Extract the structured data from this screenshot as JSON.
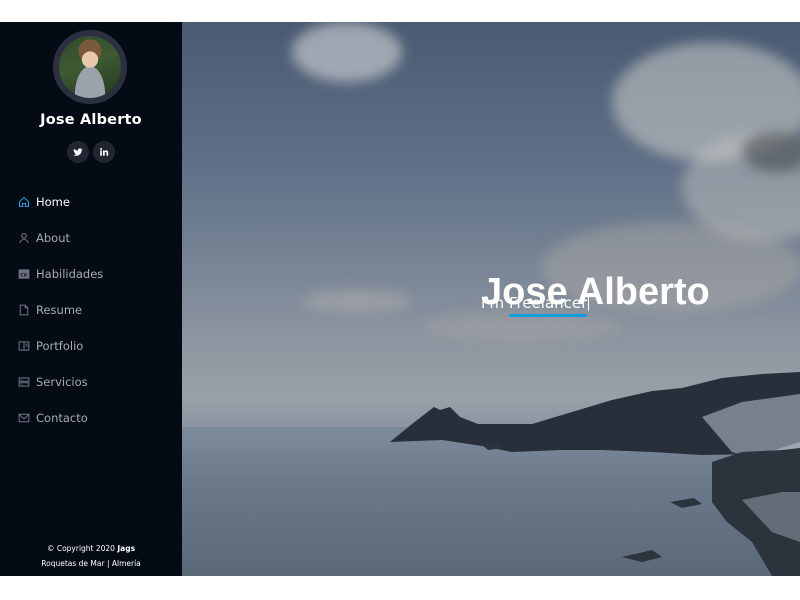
{
  "profile": {
    "name": "Jose Alberto"
  },
  "social": [
    {
      "icon": "twitter-icon",
      "glyph": "t"
    },
    {
      "icon": "linkedin-icon",
      "glyph": "in"
    }
  ],
  "nav": {
    "items": [
      {
        "label": "Home",
        "icon": "home-icon",
        "active": true
      },
      {
        "label": "About",
        "icon": "user-icon",
        "active": false
      },
      {
        "label": "Habilidades",
        "icon": "cv-icon",
        "active": false
      },
      {
        "label": "Resume",
        "icon": "file-icon",
        "active": false
      },
      {
        "label": "Portfolio",
        "icon": "book-icon",
        "active": false
      },
      {
        "label": "Servicios",
        "icon": "server-icon",
        "active": false
      },
      {
        "label": "Contacto",
        "icon": "envelope-icon",
        "active": false
      }
    ]
  },
  "footer": {
    "copyright_prefix": "© Copyright 2020",
    "copyright_brand": "Jags",
    "location": "Roquetas de Mar | Almería"
  },
  "hero": {
    "title": "Jose Alberto",
    "subtitle_prefix": "I'm",
    "typed_word": "Freelancer"
  },
  "colors": {
    "sidebar_bg": "#040b14",
    "accent": "#149ddd",
    "nav_inactive": "#a8a9b4"
  }
}
